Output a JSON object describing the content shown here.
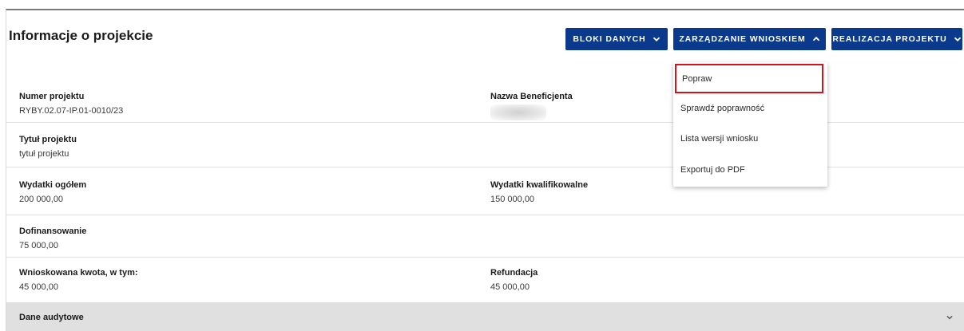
{
  "header": {
    "title": "Informacje o projekcie",
    "buttons": {
      "bloki": "BLOKI DANYCH",
      "zarzadzanie": "ZARZĄDZANIE WNIOSKIEM",
      "realizacja": "REALIZACJA PROJEKTU"
    }
  },
  "dropdown": {
    "items": [
      "Popraw",
      "Sprawdź poprawność",
      "Lista wersji wniosku",
      "Exportuj do PDF"
    ]
  },
  "fields": {
    "numer_projektu": {
      "label": "Numer projektu",
      "value": "RYBY.02.07-IP.01-0010/23"
    },
    "nazwa_beneficjenta": {
      "label": "Nazwa Beneficjenta"
    },
    "tytul_projektu": {
      "label": "Tytuł projektu",
      "value": "tytuł projektu"
    },
    "wydatki_ogolem": {
      "label": "Wydatki ogółem",
      "value": "200 000,00"
    },
    "wydatki_kwalifikowalne": {
      "label": "Wydatki kwalifikowalne",
      "value": "150 000,00"
    },
    "dofinansowanie": {
      "label": "Dofinansowanie",
      "value": "75 000,00"
    },
    "wnioskowana_kwota": {
      "label": "Wnioskowana kwota, w tym:",
      "value": "45 000,00"
    },
    "refundacja": {
      "label": "Refundacja",
      "value": "45 000,00"
    }
  },
  "audit": {
    "label": "Dane audytowe"
  },
  "colors": {
    "primary_button": "#0b3a8c",
    "highlight_border": "#d6131c",
    "audit_bar": "#e0e0e0"
  }
}
